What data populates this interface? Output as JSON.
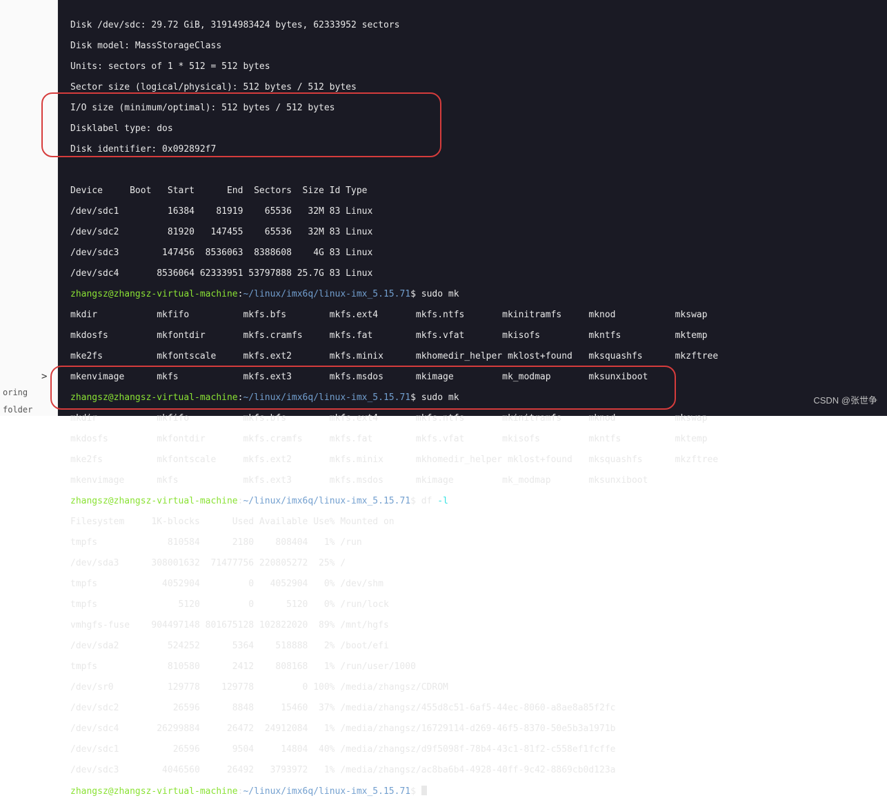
{
  "left_sidebar": {
    "item1": "oring",
    "item2": "folder",
    "chevron": ">"
  },
  "fdisk": {
    "l1": "Disk /dev/sdc: 29.72 GiB, 31914983424 bytes, 62333952 sectors",
    "l2": "Disk model: MassStorageClass",
    "l3": "Units: sectors of 1 * 512 = 512 bytes",
    "l4": "Sector size (logical/physical): 512 bytes / 512 bytes",
    "l5": "I/O size (minimum/optimal): 512 bytes / 512 bytes",
    "l6": "Disklabel type: dos",
    "l7": "Disk identifier: 0x092892f7"
  },
  "part_header": "Device     Boot   Start      End  Sectors  Size Id Type",
  "parts": [
    "/dev/sdc1         16384    81919    65536   32M 83 Linux",
    "/dev/sdc2         81920   147455    65536   32M 83 Linux",
    "/dev/sdc3        147456  8536063  8388608    4G 83 Linux",
    "/dev/sdc4       8536064 62333951 53797888 25.7G 83 Linux"
  ],
  "prompt": {
    "userhost": "zhangsz@zhangsz-virtual-machine",
    "path": "~/linux/imx6q/linux-imx_5.15.71",
    "cmd_mk": "$ sudo mk",
    "cmd_df": "$ df ",
    "df_flag": "-l",
    "cmd_blank": "$ "
  },
  "mk_rows": [
    "mkdir           mkfifo          mkfs.bfs        mkfs.ext4       mkfs.ntfs       mkinitramfs     mknod           mkswap",
    "mkdosfs         mkfontdir       mkfs.cramfs     mkfs.fat        mkfs.vfat       mkisofs         mkntfs          mktemp",
    "mke2fs          mkfontscale     mkfs.ext2       mkfs.minix      mkhomedir_helper mklost+found   mksquashfs      mkzftree",
    "mkenvimage      mkfs            mkfs.ext3       mkfs.msdos      mkimage         mk_modmap       mksunxiboot"
  ],
  "df_header": "Filesystem     1K-blocks      Used Available Use% Mounted on",
  "df_rows": [
    "tmpfs             810584      2180    808404   1% /run",
    "/dev/sda3      308001632  71477756 220805272  25% /",
    "tmpfs            4052904         0   4052904   0% /dev/shm",
    "tmpfs               5120         0      5120   0% /run/lock",
    "vmhgfs-fuse    904497148 801675128 102822020  89% /mnt/hgfs",
    "/dev/sda2         524252      5364    518888   2% /boot/efi",
    "tmpfs             810580      2412    808168   1% /run/user/1000",
    "/dev/sr0          129778    129778         0 100% /media/zhangsz/CDROM",
    "/dev/sdc2          26596      8848     15460  37% /media/zhangsz/455d8c51-6af5-44ec-8060-a8ae8a85f2fc",
    "/dev/sdc4       26299884     26472  24912084   1% /media/zhangsz/16729114-d269-46f5-8370-50e5b3a1971b",
    "/dev/sdc1          26596      9504     14804  40% /media/zhangsz/d9f5098f-78b4-43c1-81f2-c558ef1fcffe",
    "/dev/sdc3        4046560     26492   3793972   1% /media/zhangsz/ac8ba6b4-4928-40ff-9c42-8869cb0d123a"
  ],
  "watermark": "CSDN @张世争"
}
